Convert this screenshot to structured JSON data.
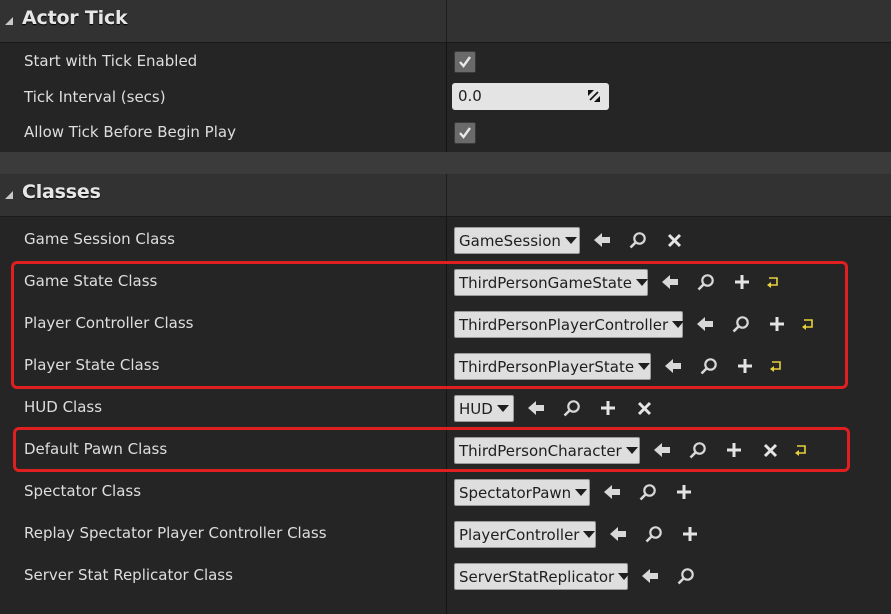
{
  "sections": {
    "actor_tick": {
      "title": "Actor Tick",
      "start_with_tick_enabled": {
        "label": "Start with Tick Enabled",
        "checked": true
      },
      "tick_interval": {
        "label": "Tick Interval (secs)",
        "value": "0.0"
      },
      "allow_tick_before_begin_play": {
        "label": "Allow Tick Before Begin Play",
        "checked": true
      }
    },
    "classes": {
      "title": "Classes",
      "rows": [
        {
          "label": "Game Session Class",
          "value": "GameSession",
          "icons": [
            "use-selected-icon",
            "browse-icon",
            "clear-icon"
          ]
        },
        {
          "label": "Game State Class",
          "value": "ThirdPersonGameState",
          "icons": [
            "use-selected-icon",
            "browse-icon",
            "new-icon",
            "reset-icon"
          ]
        },
        {
          "label": "Player Controller Class",
          "value": "ThirdPersonPlayerController",
          "icons": [
            "use-selected-icon",
            "browse-icon",
            "new-icon",
            "reset-icon"
          ]
        },
        {
          "label": "Player State Class",
          "value": "ThirdPersonPlayerState",
          "icons": [
            "use-selected-icon",
            "browse-icon",
            "new-icon",
            "reset-icon"
          ]
        },
        {
          "label": "HUD Class",
          "value": "HUD",
          "icons": [
            "use-selected-icon",
            "browse-icon",
            "new-icon",
            "clear-icon"
          ]
        },
        {
          "label": "Default Pawn Class",
          "value": "ThirdPersonCharacter",
          "icons": [
            "use-selected-icon",
            "browse-icon",
            "new-icon",
            "clear-icon",
            "reset-icon"
          ]
        },
        {
          "label": "Spectator Class",
          "value": "SpectatorPawn",
          "icons": [
            "use-selected-icon",
            "browse-icon",
            "new-icon"
          ]
        },
        {
          "label": "Replay Spectator Player Controller Class",
          "value": "PlayerController",
          "icons": [
            "use-selected-icon",
            "browse-icon",
            "new-icon"
          ]
        },
        {
          "label": "Server Stat Replicator Class",
          "value": "ServerStatReplicator",
          "icons": [
            "use-selected-icon",
            "browse-icon"
          ]
        }
      ]
    }
  },
  "colors": {
    "highlight": "#e02020",
    "reset": "#e8d23a",
    "background": "#252525",
    "header": "#323232"
  }
}
